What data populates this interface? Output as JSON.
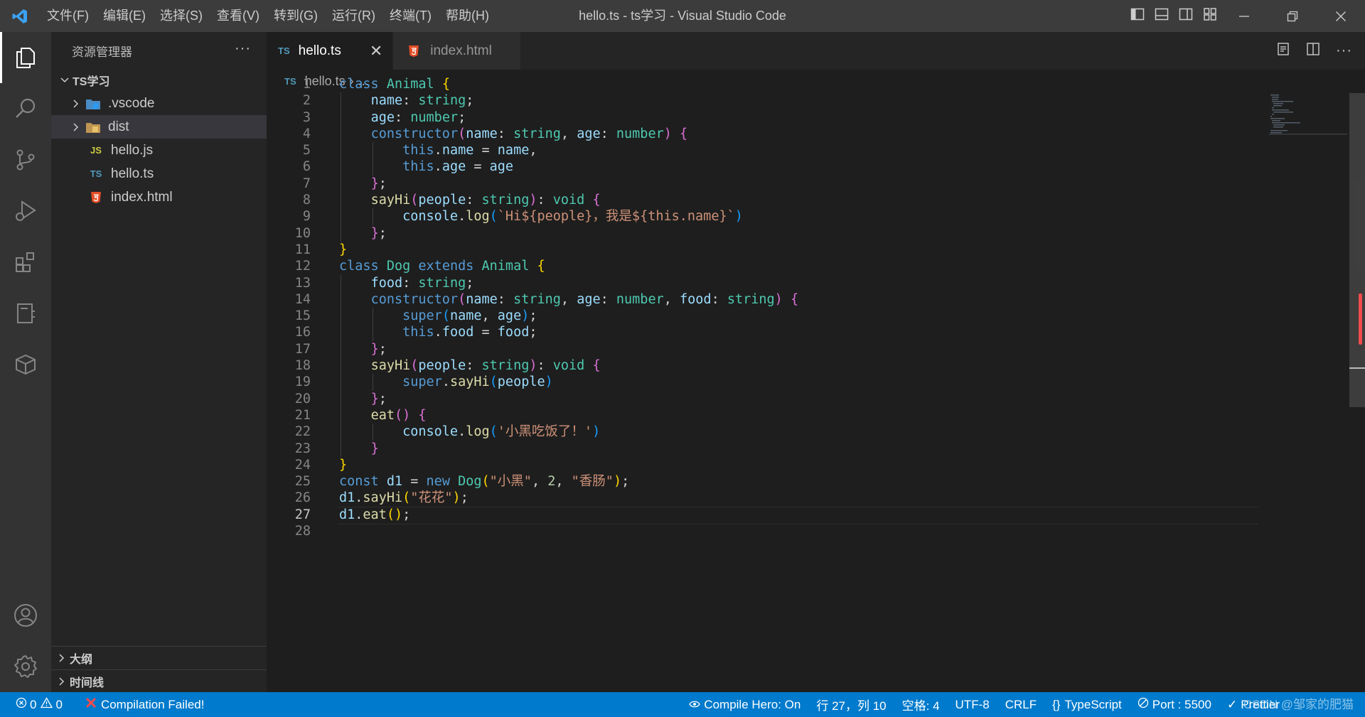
{
  "titlebar": {
    "menu": [
      "文件(F)",
      "编辑(E)",
      "选择(S)",
      "查看(V)",
      "转到(G)",
      "运行(R)",
      "终端(T)",
      "帮助(H)"
    ],
    "title": "hello.ts - ts学习 - Visual Studio Code"
  },
  "sidebar": {
    "header": "资源管理器",
    "more": "···",
    "root": "TS学习",
    "items": [
      {
        "label": ".vscode",
        "type": "folder"
      },
      {
        "label": "dist",
        "type": "folder"
      },
      {
        "label": "hello.js",
        "type": "js"
      },
      {
        "label": "hello.ts",
        "type": "ts"
      },
      {
        "label": "index.html",
        "type": "html"
      }
    ],
    "sections": [
      "大纲",
      "时间线"
    ]
  },
  "tabs": [
    {
      "label": "hello.ts",
      "badge": "TS",
      "active": true
    },
    {
      "label": "index.html",
      "badge": "html",
      "active": false
    }
  ],
  "breadcrumb": {
    "badge": "TS",
    "file": "hello.ts",
    "sep": "›",
    "rest": "..."
  },
  "editor": {
    "current_line": 27,
    "lines": [
      "1",
      "2",
      "3",
      "4",
      "5",
      "6",
      "7",
      "8",
      "9",
      "10",
      "11",
      "12",
      "13",
      "14",
      "15",
      "16",
      "17",
      "18",
      "19",
      "20",
      "21",
      "22",
      "23",
      "24",
      "25",
      "26",
      "27",
      "28"
    ],
    "strings": {
      "l9_tpl": "`Hi${people}，我是${this.name}`",
      "l22_str": "'小黑吃饭了！'",
      "l25_a": "\"小黑\"",
      "l25_b": "\"香肠\"",
      "l26_str": "\"花花\""
    }
  },
  "statusbar": {
    "errors": "0",
    "warnings": "0",
    "compile_status": "Compilation Failed!",
    "compile_hero": "Compile Hero: On",
    "position": "行 27，列 10",
    "spaces": "空格: 4",
    "encoding": "UTF-8",
    "eol": "CRLF",
    "language": "TypeScript",
    "port": "Port : 5500",
    "prettier": "Prettier",
    "watermark": "CSDN @邹家的肥猫"
  },
  "colors": {
    "statusbar": "#007acc",
    "activitybar": "#333333",
    "sidebar": "#252526",
    "editor": "#1e1e1e",
    "error": "#f14c4c"
  }
}
